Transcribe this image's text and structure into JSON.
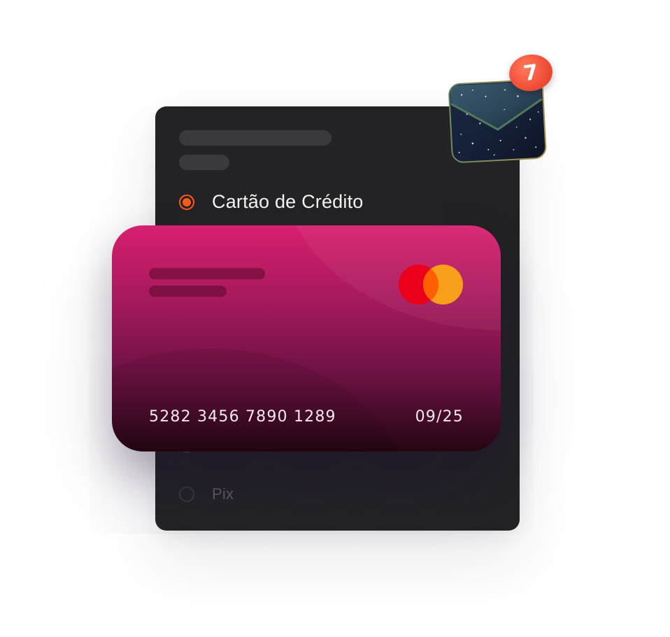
{
  "payment_panel": {
    "selected_option": {
      "label": "Cartão de Crédito",
      "selected": true
    },
    "other_option": {
      "label": "Pix",
      "selected": false
    }
  },
  "card": {
    "brand_icon": "mastercard-logo",
    "number": "5282 3456 7890 1289",
    "expiry": "09/25"
  },
  "notification": {
    "icon": "envelope-icon",
    "count": "7"
  },
  "colors": {
    "accent": "#ff5a1a",
    "panel_bg": "#232325",
    "card_top": "#d81f6f",
    "card_bottom": "#240612",
    "badge": "#f04e36"
  }
}
